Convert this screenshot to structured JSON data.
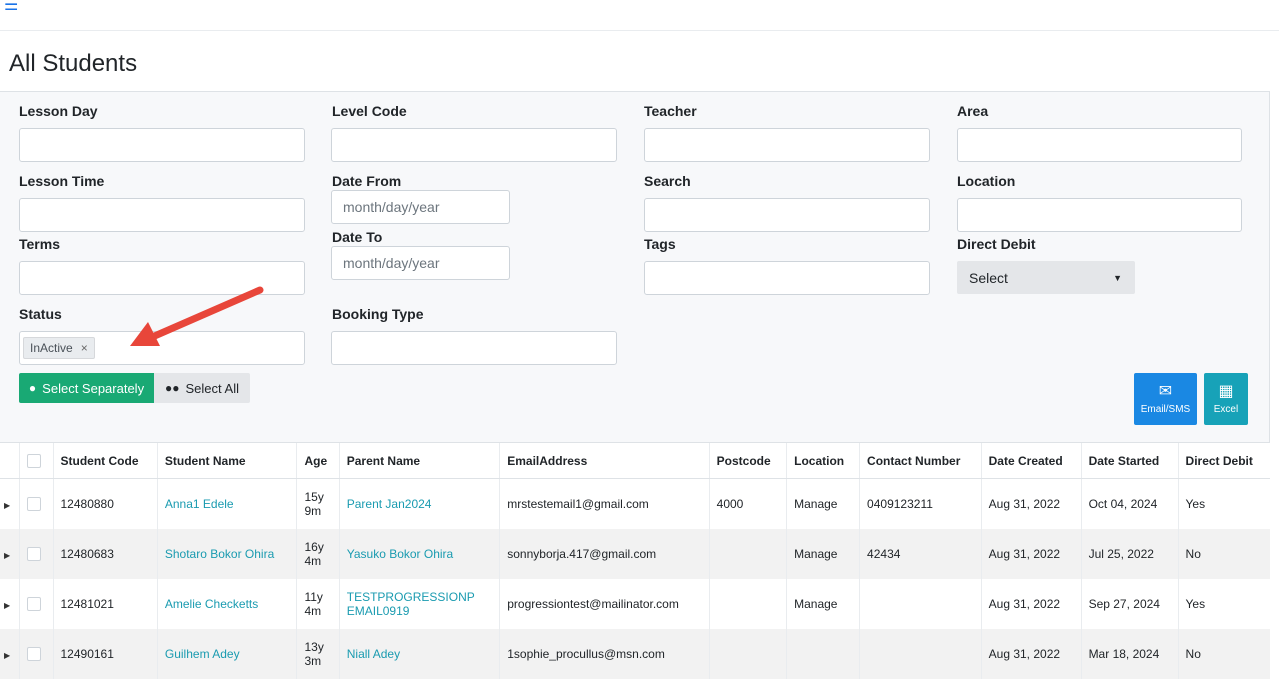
{
  "header": {
    "menu_icon": "hamburger-icon",
    "page_title": "All Students"
  },
  "filters": {
    "lesson_day": {
      "label": "Lesson Day",
      "value": ""
    },
    "level_code": {
      "label": "Level Code",
      "value": ""
    },
    "teacher": {
      "label": "Teacher",
      "value": ""
    },
    "area": {
      "label": "Area",
      "value": ""
    },
    "lesson_time": {
      "label": "Lesson Time",
      "value": ""
    },
    "date_from": {
      "label": "Date From",
      "placeholder": "month/day/year"
    },
    "search": {
      "label": "Search",
      "value": ""
    },
    "location": {
      "label": "Location",
      "value": ""
    },
    "terms": {
      "label": "Terms",
      "value": ""
    },
    "date_to": {
      "label": "Date To",
      "placeholder": "month/day/year"
    },
    "tags": {
      "label": "Tags",
      "value": ""
    },
    "direct_debit": {
      "label": "Direct Debit",
      "selected": "Select"
    },
    "status": {
      "label": "Status",
      "selected_tag": "InActive",
      "remove_glyph": "×"
    },
    "booking_type": {
      "label": "Booking Type",
      "value": ""
    }
  },
  "actions": {
    "select_separately": "Select Separately",
    "select_all": "Select All",
    "email_sms": "Email/SMS",
    "excel": "Excel"
  },
  "colors": {
    "accent_green": "#19a974",
    "accent_blue": "#1a88e3",
    "accent_teal": "#17a2b8",
    "link": "#1a9bb0",
    "arrow_red": "#e8463a"
  },
  "table": {
    "columns": [
      "Student Code",
      "Student Name",
      "Age",
      "Parent Name",
      "EmailAddress",
      "Postcode",
      "Location",
      "Contact Number",
      "Date Created",
      "Date Started",
      "Direct Debit"
    ],
    "rows": [
      {
        "student_code": "12480880",
        "student_name": "Anna1 Edele",
        "age_y": "15y",
        "age_m": "9m",
        "parent_name": "Parent Jan2024",
        "email": "mrstestemail1@gmail.com",
        "postcode": "4000",
        "location": "Manage",
        "contact": "0409123211",
        "date_created": "Aug 31, 2022",
        "date_started": "Oct 04, 2024",
        "direct_debit": "Yes"
      },
      {
        "student_code": "12480683",
        "student_name": "Shotaro Bokor Ohira",
        "age_y": "16y",
        "age_m": "4m",
        "parent_name": "Yasuko Bokor Ohira",
        "email": "sonnyborja.417@gmail.com",
        "postcode": "",
        "location": "Manage",
        "contact": "42434",
        "date_created": "Aug 31, 2022",
        "date_started": "Jul 25, 2022",
        "direct_debit": "No"
      },
      {
        "student_code": "12481021",
        "student_name": "Amelie Checketts",
        "age_y": "11y",
        "age_m": "4m",
        "parent_name_line1": "TESTPROGRESSIONP",
        "parent_name_line2": "EMAIL0919",
        "email": "progressiontest@mailinator.com",
        "postcode": "",
        "location": "Manage",
        "contact": "",
        "date_created": "Aug 31, 2022",
        "date_started": "Sep 27, 2024",
        "direct_debit": "Yes"
      },
      {
        "student_code": "12490161",
        "student_name": "Guilhem Adey",
        "age_y": "13y",
        "age_m": "3m",
        "parent_name": "Niall Adey",
        "email": "1sophie_procullus@msn.com",
        "postcode": "",
        "location": "",
        "contact": "",
        "date_created": "Aug 31, 2022",
        "date_started": "Mar 18, 2024",
        "direct_debit": "No"
      }
    ]
  }
}
